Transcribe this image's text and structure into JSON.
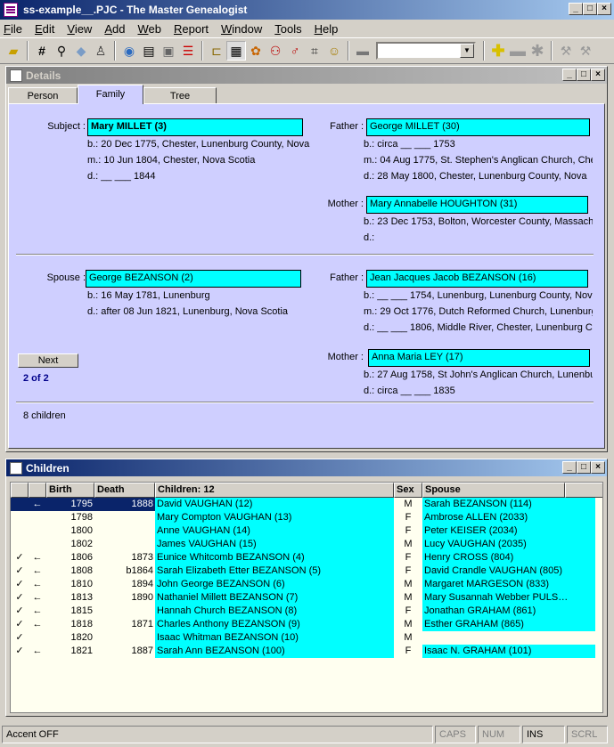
{
  "app": {
    "title": "ss-example__.PJC - The Master Genealogist"
  },
  "menu": [
    "File",
    "Edit",
    "View",
    "Add",
    "Web",
    "Report",
    "Window",
    "Tools",
    "Help"
  ],
  "toolbar": {
    "combo_value": ""
  },
  "details": {
    "title": "Details",
    "tabs": [
      "Person",
      "Family",
      "Tree"
    ],
    "subject": {
      "label": "Subject :",
      "name": "Mary MILLET (3)",
      "events": [
        "b.: 20 Dec 1775, Chester, Lunenburg County, Nova",
        "m.: 10 Jun 1804, Chester, Nova Scotia",
        "d.: __ ___ 1844"
      ]
    },
    "father": {
      "label": "Father :",
      "name": "George MILLET (30)",
      "events": [
        "b.: circa __ ___ 1753",
        "m.: 04 Aug 1775, St. Stephen's Anglican Church, Che",
        "d.: 28 May 1800, Chester, Lunenburg County, Nova"
      ]
    },
    "mother": {
      "label": "Mother :",
      "name": "Mary Annabelle HOUGHTON (31)",
      "events": [
        "b.: 23 Dec 1753, Bolton, Worcester County, Massach",
        "d.:"
      ]
    },
    "spouse": {
      "label": "Spouse :",
      "name": "George BEZANSON (2)",
      "events": [
        "b.: 16 May 1781, Lunenburg",
        "d.: after 08 Jun 1821, Lunenburg, Nova Scotia"
      ]
    },
    "spouse_father": {
      "label": "Father :",
      "name": "Jean Jacques Jacob BEZANSON (16)",
      "events": [
        "b.: __ ___ 1754, Lunenburg, Lunenburg County, Nov",
        "m.: 29 Oct 1776, Dutch Reformed Church, Lunenburg",
        "d.: __ ___ 1806, Middle River, Chester, Lunenburg C"
      ]
    },
    "spouse_mother": {
      "label": "Mother :",
      "name": "Anna Maria LEY (17)",
      "events": [
        "b.: 27 Aug 1758, St John's Anglican Church, Lunenbu",
        "d.: circa __ ___ 1835"
      ]
    },
    "next_label": "Next",
    "counter": "2 of 2",
    "children_count": "8 children"
  },
  "children": {
    "title": "Children",
    "headers": [
      "",
      "",
      "Birth",
      "Death",
      "Children: 12",
      "Sex",
      "Spouse"
    ],
    "rows": [
      [
        "",
        "←",
        "1795",
        "1888",
        "David VAUGHAN (12)",
        "M",
        "Sarah BEZANSON (114)"
      ],
      [
        "",
        "",
        "1798",
        "",
        "Mary Compton VAUGHAN (13)",
        "F",
        "Ambrose ALLEN (2033)"
      ],
      [
        "",
        "",
        "1800",
        "",
        "Anne VAUGHAN (14)",
        "F",
        "Peter KEISER (2034)"
      ],
      [
        "",
        "",
        "1802",
        "",
        "James VAUGHAN (15)",
        "M",
        "Lucy VAUGHAN (2035)"
      ],
      [
        "✓",
        "←",
        "1806",
        "1873",
        "Eunice Whitcomb BEZANSON (4)",
        "F",
        "Henry CROSS (804)"
      ],
      [
        "✓",
        "←",
        "1808",
        "b1864",
        "Sarah Elizabeth Etter BEZANSON (5)",
        "F",
        "David Crandle VAUGHAN (805)"
      ],
      [
        "✓",
        "←",
        "1810",
        "1894",
        "John George BEZANSON (6)",
        "M",
        "Margaret MARGESON (833)"
      ],
      [
        "✓",
        "←",
        "1813",
        "1890",
        "Nathaniel Millett BEZANSON (7)",
        "M",
        "Mary Susannah Webber PULS…"
      ],
      [
        "✓",
        "←",
        "1815",
        "",
        "Hannah Church BEZANSON (8)",
        "F",
        "Jonathan GRAHAM (861)"
      ],
      [
        "✓",
        "←",
        "1818",
        "1871",
        "Charles Anthony BEZANSON (9)",
        "M",
        "Esther GRAHAM (865)"
      ],
      [
        "✓",
        "",
        "1820",
        "",
        "Isaac Whitman BEZANSON (10)",
        "M",
        ""
      ],
      [
        "✓",
        "←",
        "1821",
        "1887",
        "Sarah Ann BEZANSON (100)",
        "F",
        "Isaac N. GRAHAM (101)"
      ]
    ]
  },
  "status": {
    "main": "Accent OFF",
    "caps": "CAPS",
    "num": "NUM",
    "ins": "INS",
    "scrl": "SCRL"
  }
}
